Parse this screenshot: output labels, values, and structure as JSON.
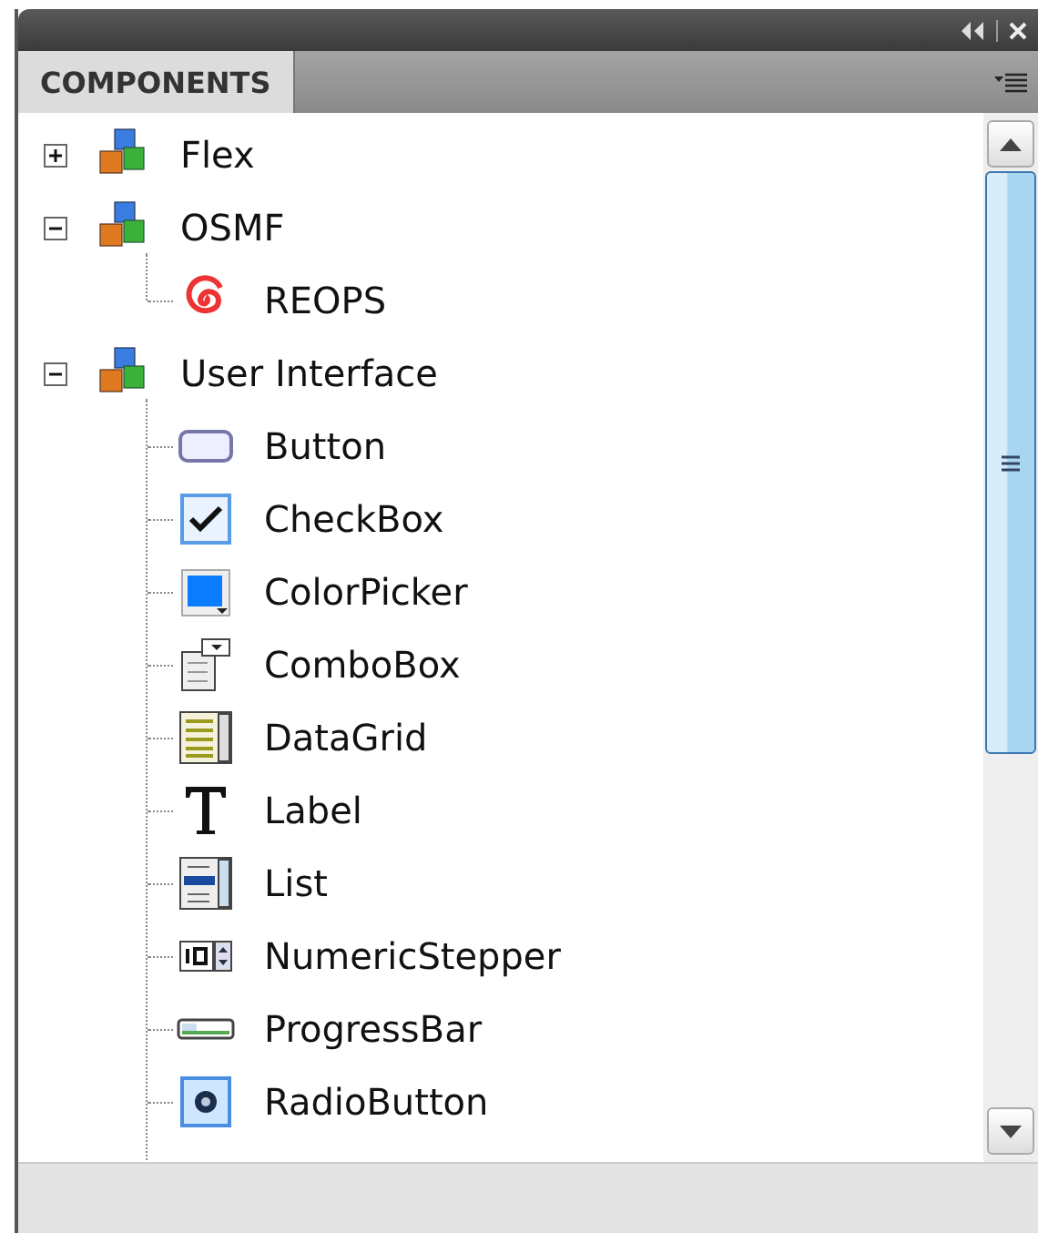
{
  "panel": {
    "tab": {
      "label": "COMPONENTS",
      "selected": true
    }
  },
  "tree": [
    {
      "label": "Flex",
      "kind": "package",
      "expanded": false
    },
    {
      "label": "OSMF",
      "kind": "package",
      "expanded": true,
      "children": [
        {
          "label": "REOPS",
          "kind": "spiral"
        }
      ]
    },
    {
      "label": "User Interface",
      "kind": "package",
      "expanded": true,
      "children": [
        {
          "label": "Button",
          "kind": "button"
        },
        {
          "label": "CheckBox",
          "kind": "checkbox"
        },
        {
          "label": "ColorPicker",
          "kind": "colorpicker"
        },
        {
          "label": "ComboBox",
          "kind": "combobox"
        },
        {
          "label": "DataGrid",
          "kind": "datagrid"
        },
        {
          "label": "Label",
          "kind": "label"
        },
        {
          "label": "List",
          "kind": "list"
        },
        {
          "label": "NumericStepper",
          "kind": "stepper"
        },
        {
          "label": "ProgressBar",
          "kind": "progressbar"
        },
        {
          "label": "RadioButton",
          "kind": "radio"
        }
      ]
    }
  ]
}
